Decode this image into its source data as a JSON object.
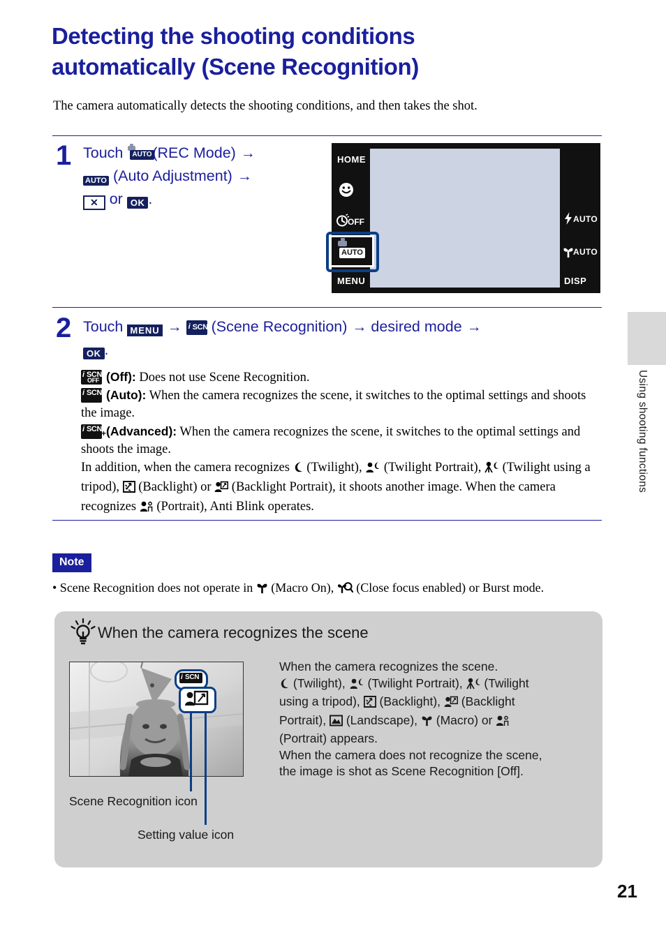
{
  "page": {
    "number": "21",
    "side_tab_text": "Using shooting functions"
  },
  "heading": {
    "line1": "Detecting the shooting conditions",
    "line2": "automatically (Scene Recognition)",
    "color": "#1a1f9c"
  },
  "intro": "The camera automatically detects the shooting conditions, and then takes the shot.",
  "steps": [
    {
      "number": "1",
      "text_parts": {
        "touch": "Touch",
        "rec_mode_label": "(REC Mode)",
        "auto_adjustment_label": "(Auto Adjustment)",
        "or": "or",
        "period": ".",
        "arrow": "→"
      },
      "icons": {
        "rec_mode": "rec-mode-auto-icon",
        "auto": "AUTO",
        "cancel": "✕",
        "ok": "OK"
      }
    },
    {
      "number": "2",
      "text_parts": {
        "touch": "Touch",
        "menu": "MENU",
        "scene_recognition_label": "(Scene Recognition)",
        "desired_mode": "desired mode",
        "ok": "OK",
        "period": ".",
        "arrow": "→"
      }
    }
  ],
  "modes": [
    {
      "icon_name": "iscn-off-icon",
      "icon_i": "i",
      "icon_s": "SCN",
      "icon_sub": "OFF",
      "label": "(Off):",
      "description": "Does not use Scene Recognition."
    },
    {
      "icon_name": "iscn-auto-icon",
      "icon_i": "i",
      "icon_s": "SCN",
      "icon_sub": "",
      "label": "(Auto):",
      "description": "When the camera recognizes the scene, it switches to the optimal settings and shoots the image."
    },
    {
      "icon_name": "iscn-advanced-icon",
      "icon_i": "i",
      "icon_s": "SCN",
      "icon_sub": "",
      "plus": "+",
      "label": "(Advanced):",
      "description": "When the camera recognizes the scene, it switches to the optimal settings and shoots the image."
    }
  ],
  "additional_paragraph": {
    "part1": "In addition, when the camera recognizes",
    "twilight": "(Twilight),",
    "twilight_portrait": "(Twilight Portrait),",
    "twilight_tripod": "(Twilight using a tripod),",
    "backlight": "(Backlight) or",
    "backlight_portrait": "(Backlight Portrait), it shoots another image. When the camera recognizes",
    "portrait": "(Portrait), Anti Blink operates."
  },
  "camera_screen": {
    "left_buttons": [
      "HOME",
      "smile-shutter-icon",
      "self-timer-off-icon",
      "rec-mode-auto-icon",
      "MENU"
    ],
    "home_label": "HOME",
    "menu_label": "MENU",
    "self_timer_label": "OFF",
    "rec_mode_label": "AUTO",
    "right_buttons": [
      "flash-auto-icon",
      "macro-auto-icon",
      "DISP"
    ],
    "flash_label": "AUTO",
    "macro_label": "AUTO",
    "disp_label": "DISP",
    "highlight_color": "#0b3f86"
  },
  "note": {
    "badge": "Note",
    "text_part1": "• Scene Recognition does not operate in",
    "macro_on": "(Macro On),",
    "close_focus": "(Close focus enabled) or Burst mode."
  },
  "tip": {
    "title": "When the camera recognizes the scene",
    "icon": "lightbulb-icon",
    "body_lines": [
      "When the camera recognizes the scene.",
      "(Twilight), (Twilight Portrait), (Twilight",
      "using a tripod), (Backlight), (Backlight",
      "Portrait), (Landscape), (Macro) or",
      "(Portrait) appears.",
      "When the camera does not recognize the scene,",
      "the image is shot as Scene Recognition [Off]."
    ],
    "body": {
      "l1": "When the camera recognizes the scene.",
      "twilight": "(Twilight),",
      "twilight_portrait": "(Twilight Portrait),",
      "twilight_tripod": "(Twilight",
      "tripod_cont": "using a tripod),",
      "backlight": "(Backlight),",
      "backlight_portrait": "(Backlight",
      "portrait_cont": "Portrait),",
      "landscape": "(Landscape),",
      "macro": "(Macro) or",
      "portrait": "(Portrait) appears.",
      "l6": "When the camera does not recognize the scene,",
      "l7": "the image is shot as Scene Recognition [Off]."
    },
    "caption_1": "Scene Recognition icon",
    "caption_2": "Setting value icon",
    "overlay_icon_1": "iscn-icon",
    "overlay_icon_2": "backlight-portrait-icon",
    "callout_color": "#0b3f86"
  }
}
